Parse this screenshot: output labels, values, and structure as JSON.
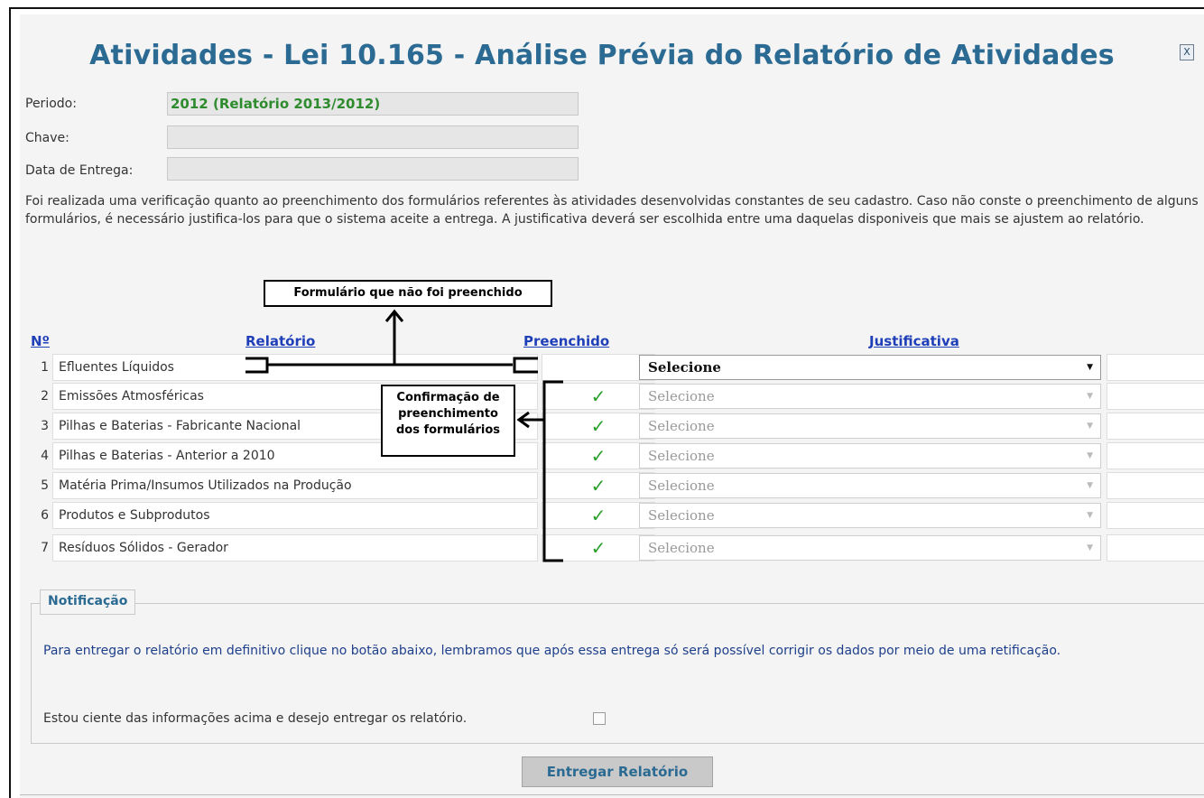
{
  "dialog": {
    "title": "Atividades - Lei 10.165 - Análise Prévia do Relatório de Atividades",
    "close_label": "X"
  },
  "form": {
    "periodo_label": "Periodo:",
    "periodo_value": "2012 (Relatório 2013/2012)",
    "chave_label": "Chave:",
    "chave_value": "",
    "data_entrega_label": "Data de Entrega:",
    "data_entrega_value": ""
  },
  "intro_text": "Foi realizada uma verificação quanto ao preenchimento dos formulários referentes às atividades desenvolvidas constantes de seu cadastro. Caso não conste o preenchimento de alguns formulários, é necessário justifica-los para que o sistema aceite a entrega. A justificativa deverá ser escolhida entre uma daquelas disponiveis que mais se ajustem ao relatório.",
  "annotations": {
    "unfilled": "Formulário que não foi preenchido",
    "confirm_line1": "Confirmação de",
    "confirm_line2": "preenchimento",
    "confirm_line3": "dos formulários"
  },
  "table": {
    "headers": {
      "no": "Nº",
      "relatorio": "Relatório",
      "preenchido": "Preenchido",
      "justificativa": "Justificativa"
    },
    "rows": [
      {
        "no": "1",
        "relatorio": "Efluentes Líquidos",
        "preenchido": "",
        "justificativa": "Selecione"
      },
      {
        "no": "2",
        "relatorio": "Emissões Atmosféricas",
        "preenchido": "✓",
        "justificativa": "Selecione"
      },
      {
        "no": "3",
        "relatorio": "Pilhas e Baterias - Fabricante Nacional",
        "preenchido": "✓",
        "justificativa": "Selecione"
      },
      {
        "no": "4",
        "relatorio": "Pilhas e Baterias - Anterior a 2010",
        "preenchido": "✓",
        "justificativa": "Selecione"
      },
      {
        "no": "5",
        "relatorio": "Matéria Prima/Insumos Utilizados na Produção",
        "preenchido": "✓",
        "justificativa": "Selecione"
      },
      {
        "no": "6",
        "relatorio": "Produtos e Subprodutos",
        "preenchido": "✓",
        "justificativa": "Selecione"
      },
      {
        "no": "7",
        "relatorio": "Resíduos Sólidos - Gerador",
        "preenchido": "✓",
        "justificativa": "Selecione"
      }
    ]
  },
  "notification": {
    "legend": "Notificação",
    "text": "Para entregar o relatório em definitivo clique no botão abaixo, lembramos que após essa entrega só será possível corrigir os dados por meio de uma retificação.",
    "ack_label": "Estou ciente das informações acima e desejo entregar os relatório."
  },
  "submit_label": "Entregar Relatório",
  "colors": {
    "title": "#2b6a92",
    "header_link": "#1f3fb8",
    "check": "#2aa02a",
    "periodo_value": "#2e8b2e"
  }
}
